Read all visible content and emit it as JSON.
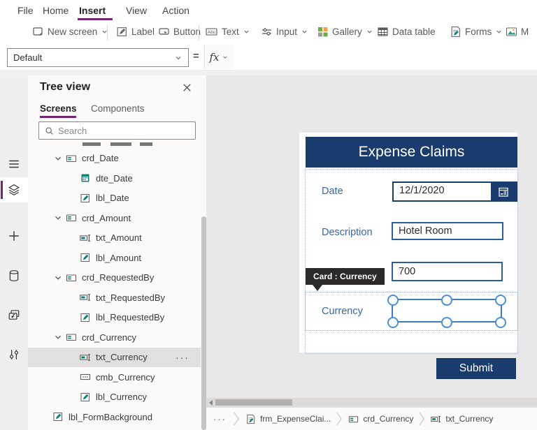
{
  "menu": {
    "items": [
      {
        "label": "File",
        "active": false
      },
      {
        "label": "Home",
        "active": false
      },
      {
        "label": "Insert",
        "active": true
      },
      {
        "label": "View",
        "active": false
      },
      {
        "label": "Action",
        "active": false
      }
    ]
  },
  "toolbar": {
    "new_screen": "New screen",
    "label": "Label",
    "button": "Button",
    "text": "Text",
    "input": "Input",
    "gallery": "Gallery",
    "data_table": "Data table",
    "forms": "Forms",
    "media_partial": "M"
  },
  "formula_bar": {
    "property_selected": "Default",
    "equals": "=",
    "fx_label": "fx",
    "value": ""
  },
  "left_rail": {
    "icons": [
      "hamburger-icon",
      "tree-view-icon",
      "plus-icon",
      "data-sources-icon",
      "media-icon",
      "advanced-tools-icon"
    ],
    "selected": "tree-view-icon"
  },
  "tree_panel": {
    "title": "Tree view",
    "tabs": [
      {
        "label": "Screens",
        "active": true
      },
      {
        "label": "Components",
        "active": false
      }
    ],
    "search_placeholder": "Search",
    "ellipsis": "···",
    "items": [
      {
        "icon": "card-icon",
        "label": "crd_Date",
        "expanded": true
      },
      {
        "icon": "date-picker-icon",
        "label": "dte_Date"
      },
      {
        "icon": "label-icon",
        "label": "lbl_Date"
      },
      {
        "icon": "card-icon",
        "label": "crd_Amount",
        "expanded": true
      },
      {
        "icon": "text-input-icon",
        "label": "txt_Amount"
      },
      {
        "icon": "label-icon",
        "label": "lbl_Amount"
      },
      {
        "icon": "card-icon",
        "label": "crd_RequestedBy",
        "expanded": true
      },
      {
        "icon": "text-input-icon",
        "label": "txt_RequestedBy"
      },
      {
        "icon": "label-icon",
        "label": "lbl_RequestedBy"
      },
      {
        "icon": "card-icon",
        "label": "crd_Currency",
        "expanded": true
      },
      {
        "icon": "text-input-icon",
        "label": "txt_Currency",
        "selected": true
      },
      {
        "icon": "combobox-icon",
        "label": "cmb_Currency"
      },
      {
        "icon": "label-icon",
        "label": "lbl_Currency"
      },
      {
        "icon": "label-icon",
        "label": "lbl_FormBackground"
      }
    ]
  },
  "canvas": {
    "form": {
      "title": "Expense Claims",
      "fields": {
        "date": {
          "label": "Date",
          "value": "12/1/2020"
        },
        "description": {
          "label": "Description",
          "value": "Hotel Room"
        },
        "amount": {
          "value": "700"
        },
        "currency": {
          "label": "Currency",
          "selected": true
        }
      },
      "tooltip": "Card : Currency",
      "submit_label": "Submit"
    }
  },
  "breadcrumb": {
    "overflow": "···",
    "items": [
      {
        "icon": "form-icon",
        "label": "frm_ExpenseClai..."
      },
      {
        "icon": "card-icon",
        "label": "crd_Currency"
      },
      {
        "icon": "text-input-icon",
        "label": "txt_Currency"
      }
    ]
  },
  "colors": {
    "accent_purple": "#742774",
    "navy": "#1a3c6d",
    "teal_icon": "#0b8276",
    "field_label_blue": "#3a67a8",
    "input_border_blue": "#2f5e9e",
    "selection_blue": "#3f7ac0",
    "canvas_bg": "#e8e8e8"
  }
}
